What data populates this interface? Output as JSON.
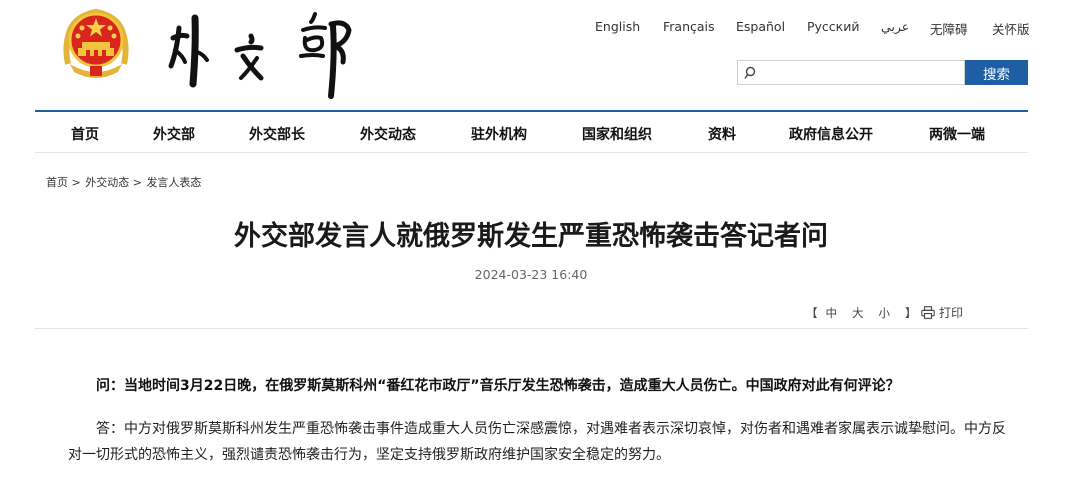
{
  "header": {
    "logo_text": "外交部",
    "languages": [
      {
        "label": "English"
      },
      {
        "label": "Français"
      },
      {
        "label": "Español"
      },
      {
        "label": "Русский"
      },
      {
        "label": "عربي"
      },
      {
        "label": "无障碍"
      },
      {
        "label": "关怀版"
      }
    ],
    "search": {
      "placeholder": "",
      "value": "",
      "button_label": "搜索"
    },
    "accent_color": "#1f5da5"
  },
  "nav": {
    "items": [
      {
        "label": "首页"
      },
      {
        "label": "外交部"
      },
      {
        "label": "外交部长"
      },
      {
        "label": "外交动态"
      },
      {
        "label": "驻外机构"
      },
      {
        "label": "国家和组织"
      },
      {
        "label": "资料"
      },
      {
        "label": "政府信息公开"
      },
      {
        "label": "两微一端"
      }
    ]
  },
  "breadcrumb": {
    "items": [
      "首页",
      "外交动态",
      "发言人表态"
    ],
    "separator": ">"
  },
  "article": {
    "title": "外交部发言人就俄罗斯发生严重恐怖袭击答记者问",
    "date": "2024-03-23 16:40",
    "font_size": {
      "open": "【",
      "large": "中",
      "medium": "大",
      "small": "小",
      "close": "】"
    },
    "print_label": "打印",
    "question": "问：当地时间3月22日晚，在俄罗斯莫斯科州“番红花市政厅”音乐厅发生恐怖袭击，造成重大人员伤亡。中国政府对此有何评论？",
    "answer": "答：中方对俄罗斯莫斯科州发生严重恐怖袭击事件造成重大人员伤亡深感震惊，对遇难者表示深切哀悼，对伤者和遇难者家属表示诚挚慰问。中方反对一切形式的恐怖主义，强烈谴责恐怖袭击行为，坚定支持俄罗斯政府维护国家安全稳定的努力。"
  }
}
